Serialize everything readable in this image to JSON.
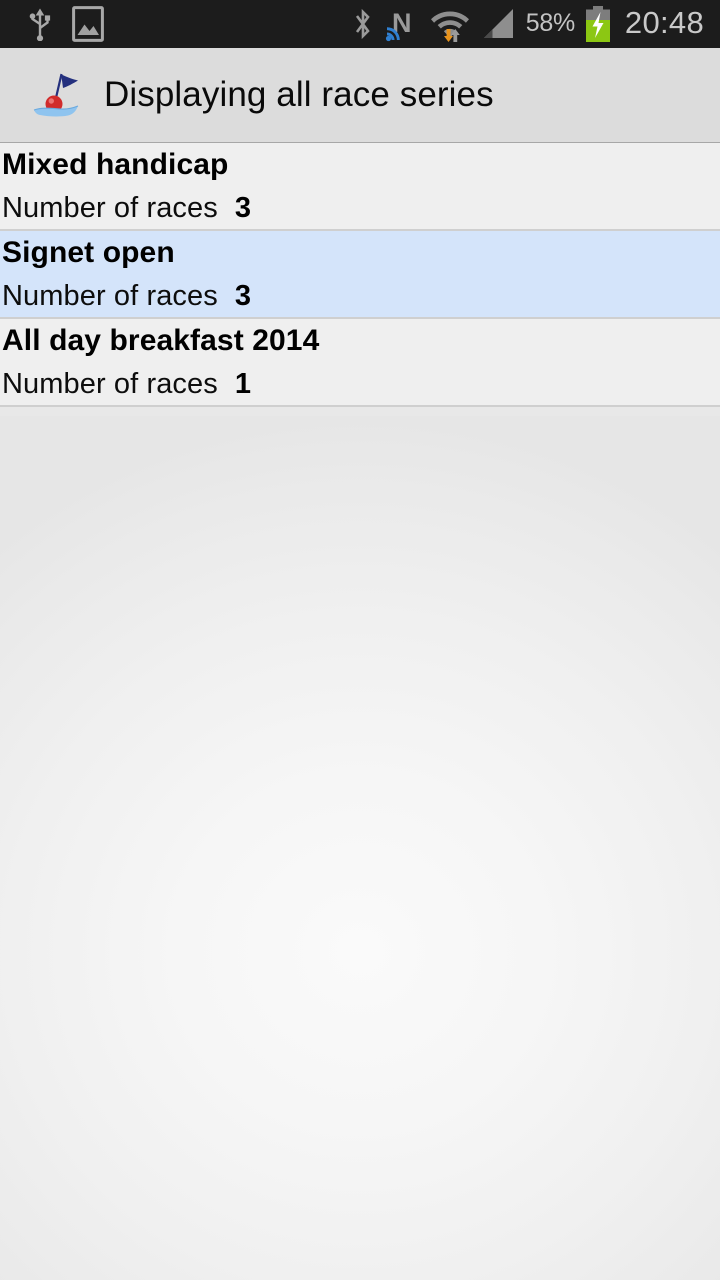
{
  "status_bar": {
    "left_icons": [
      {
        "name": "usb-icon",
        "label": "USB connected"
      },
      {
        "name": "screenshot-icon",
        "label": "Screenshot captured"
      }
    ],
    "right_icons": [
      {
        "name": "bluetooth-icon",
        "label": "Bluetooth"
      },
      {
        "name": "nfc-icon",
        "label": "NFC"
      },
      {
        "name": "wifi-icon",
        "label": "Wi-Fi"
      },
      {
        "name": "cellular-signal-icon",
        "label": "Mobile signal"
      }
    ],
    "battery_percent": "58%",
    "battery_charging": true,
    "clock": "20:48"
  },
  "header": {
    "title": "Displaying all race series",
    "icon": "race-buoy-icon"
  },
  "series_list": [
    {
      "title": "Mixed handicap",
      "races_label": "Number of races",
      "races_count": "3",
      "selected": false
    },
    {
      "title": "Signet open",
      "races_label": "Number of races",
      "races_count": "3",
      "selected": true
    },
    {
      "title": "All day breakfast 2014",
      "races_label": "Number of races",
      "races_count": "1",
      "selected": false
    }
  ],
  "colors": {
    "status_bar_bg": "#1c1c1c",
    "action_bar_bg": "#dcdcdc",
    "row_bg": "#efefef",
    "row_selected_bg": "#d4e4fa",
    "divider": "#cfcfcf",
    "battery_green": "#8cc713",
    "nfc_blue": "#2f7fd0",
    "buoy_red": "#d12b2b",
    "flag_navy": "#24307e",
    "water_blue": "#8fc4ef"
  }
}
